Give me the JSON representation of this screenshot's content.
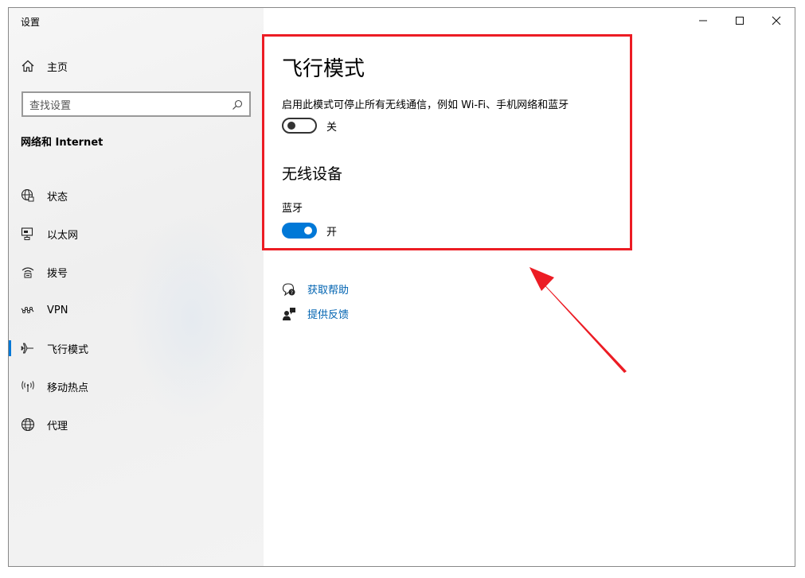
{
  "window": {
    "title": "设置",
    "controls": {
      "minimize": "minimize",
      "maximize": "maximize",
      "close": "close"
    }
  },
  "sidebar": {
    "home_label": "主页",
    "search": {
      "placeholder": "查找设置"
    },
    "section_title": "网络和 Internet",
    "items": [
      {
        "label": "状态",
        "icon": "status-globe-icon"
      },
      {
        "label": "以太网",
        "icon": "ethernet-icon"
      },
      {
        "label": "拨号",
        "icon": "dialup-icon"
      },
      {
        "label": "VPN",
        "icon": "vpn-icon"
      },
      {
        "label": "飞行模式",
        "icon": "airplane-icon",
        "active": true
      },
      {
        "label": "移动热点",
        "icon": "hotspot-icon"
      },
      {
        "label": "代理",
        "icon": "proxy-globe-icon"
      }
    ]
  },
  "main": {
    "title": "飞行模式",
    "description": "启用此模式可停止所有无线通信，例如 Wi-Fi、手机网络和蓝牙",
    "airplane_toggle": {
      "state": "off",
      "state_label": "关"
    },
    "wireless_title": "无线设备",
    "bluetooth": {
      "label": "蓝牙",
      "state": "on",
      "state_label": "开"
    },
    "links": [
      {
        "label": "获取帮助",
        "icon": "help-chat-icon"
      },
      {
        "label": "提供反馈",
        "icon": "feedback-person-icon"
      }
    ]
  },
  "colors": {
    "accent": "#0078d7",
    "link": "#0063b1",
    "annotation": "#ec1c24"
  }
}
